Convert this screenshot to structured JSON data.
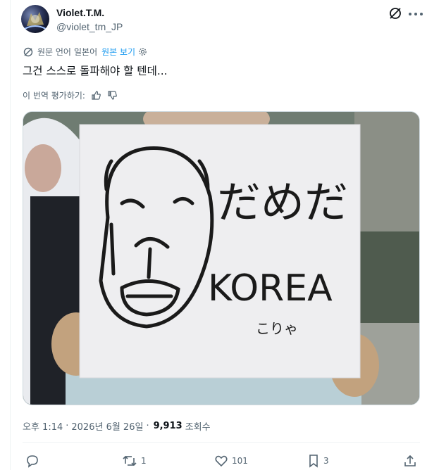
{
  "author": {
    "display_name": "Violet.T.M.",
    "handle": "@violet_tm_JP"
  },
  "translation": {
    "original_language_label": "원문 언어",
    "original_language": "일본어",
    "view_original_link": "원본 보기"
  },
  "tweet": {
    "text": "그건 스스로 돌파해야 할 텐데..."
  },
  "rating": {
    "prompt": "이 번역 평가하기:"
  },
  "media": {
    "sign_text_jp": "だめだ",
    "sign_text_en": "KOREA",
    "sign_text_kana": "こりゃ"
  },
  "meta": {
    "time": "오후 1:14",
    "separator": "·",
    "date": "2026년 6월 26일",
    "separator2": "·",
    "views_count": "9,913",
    "views_label": "조회수"
  },
  "actions": {
    "reply_count": "",
    "retweet_count": "1",
    "like_count": "101",
    "bookmark_count": "3"
  },
  "colors": {
    "accent": "#1d9bf0",
    "secondary_text": "#536471",
    "primary_text": "#0f1419"
  }
}
